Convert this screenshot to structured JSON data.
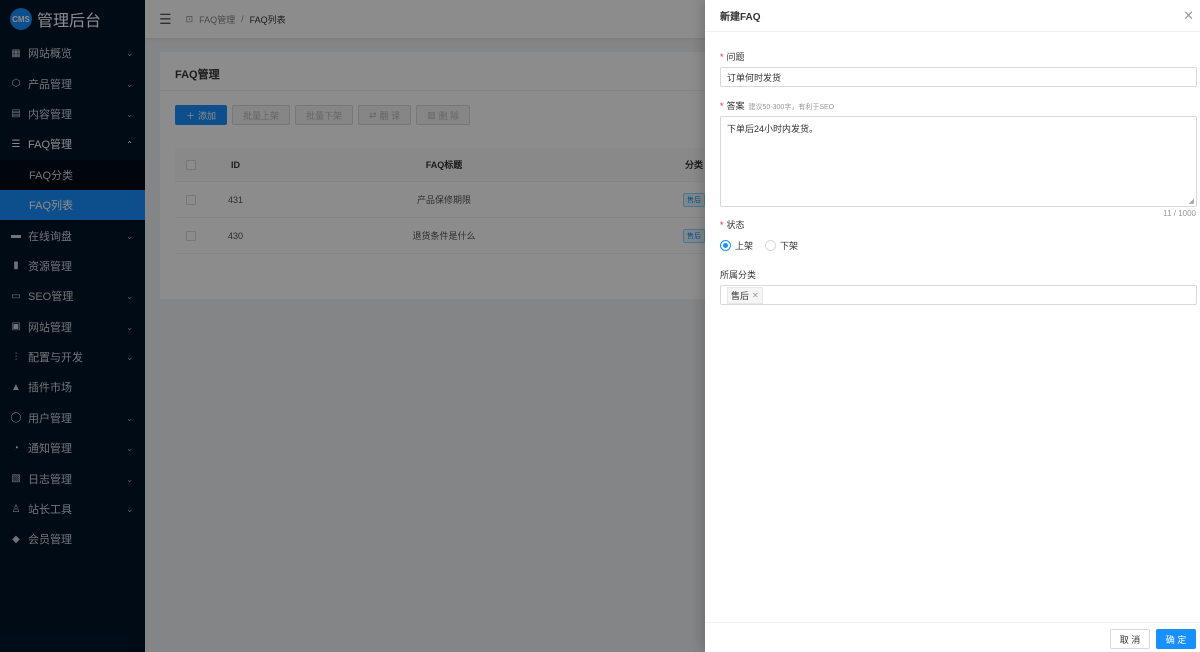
{
  "logo": {
    "badge": "CMS",
    "title": "管理后台"
  },
  "sidebar": {
    "items": [
      {
        "icon": "dashboard-icon",
        "glyph": "▦",
        "label": "网站概览",
        "chevron": "⌄"
      },
      {
        "icon": "cube-icon",
        "glyph": "⬡",
        "label": "产品管理",
        "chevron": "⌄"
      },
      {
        "icon": "document-icon",
        "glyph": "▤",
        "label": "内容管理",
        "chevron": "⌄"
      },
      {
        "icon": "faq-icon",
        "glyph": "☰",
        "label": "FAQ管理",
        "chevron": "⌃"
      },
      {
        "icon": "chat-icon",
        "glyph": "▬",
        "label": "在线询盘",
        "chevron": "⌄"
      },
      {
        "icon": "folder-icon",
        "glyph": "▮",
        "label": "资源管理",
        "chevron": ""
      },
      {
        "icon": "monitor-icon",
        "glyph": "▭",
        "label": "SEO管理",
        "chevron": "⌄"
      },
      {
        "icon": "site-icon",
        "glyph": "▣",
        "label": "网站管理",
        "chevron": "⌄"
      },
      {
        "icon": "sliders-icon",
        "glyph": "⫶",
        "label": "配置与开发",
        "chevron": "⌄"
      },
      {
        "icon": "lock-icon",
        "glyph": "▲",
        "label": "插件市场",
        "chevron": ""
      },
      {
        "icon": "user-icon",
        "glyph": "◯",
        "label": "用户管理",
        "chevron": "⌄"
      },
      {
        "icon": "bell-icon",
        "glyph": "◔",
        "label": "通知管理",
        "chevron": "⌄"
      },
      {
        "icon": "log-icon",
        "glyph": "▧",
        "label": "日志管理",
        "chevron": "⌄"
      },
      {
        "icon": "tool-icon",
        "glyph": "♙",
        "label": "站长工具",
        "chevron": "⌄"
      },
      {
        "icon": "diamond-icon",
        "glyph": "◆",
        "label": "会员管理",
        "chevron": ""
      }
    ],
    "faq_sub": [
      "FAQ分类",
      "FAQ列表"
    ]
  },
  "header": {
    "breadcrumb": [
      "FAQ管理",
      "/",
      "FAQ列表"
    ]
  },
  "card": {
    "title": "FAQ管理",
    "buttons": [
      "添加",
      "批量上架",
      "批量下架",
      "翻 译",
      "删 除"
    ],
    "columns": [
      "ID",
      "FAQ标题",
      "分类"
    ],
    "rows": [
      {
        "id": "431",
        "title": "产品保修期限",
        "cat": "售后"
      },
      {
        "id": "430",
        "title": "退货条件是什么",
        "cat": "售后"
      }
    ]
  },
  "drawer": {
    "title": "新建FAQ",
    "question_label": "问题",
    "question_value": "订单何时发货",
    "answer_label": "答案",
    "answer_hint": "建议50-300字，有利于SEO",
    "answer_value": "下单后24小时内发货。",
    "answer_count": "11 / 1000",
    "status_label": "状态",
    "status_options": [
      "上架",
      "下架"
    ],
    "status_selected": "上架",
    "category_label": "所属分类",
    "category_tag": "售后",
    "cancel": "取 消",
    "ok": "确 定"
  },
  "colors": {
    "primary": "#1890ff",
    "sidebar": "#001529",
    "required": "#f5222d"
  }
}
